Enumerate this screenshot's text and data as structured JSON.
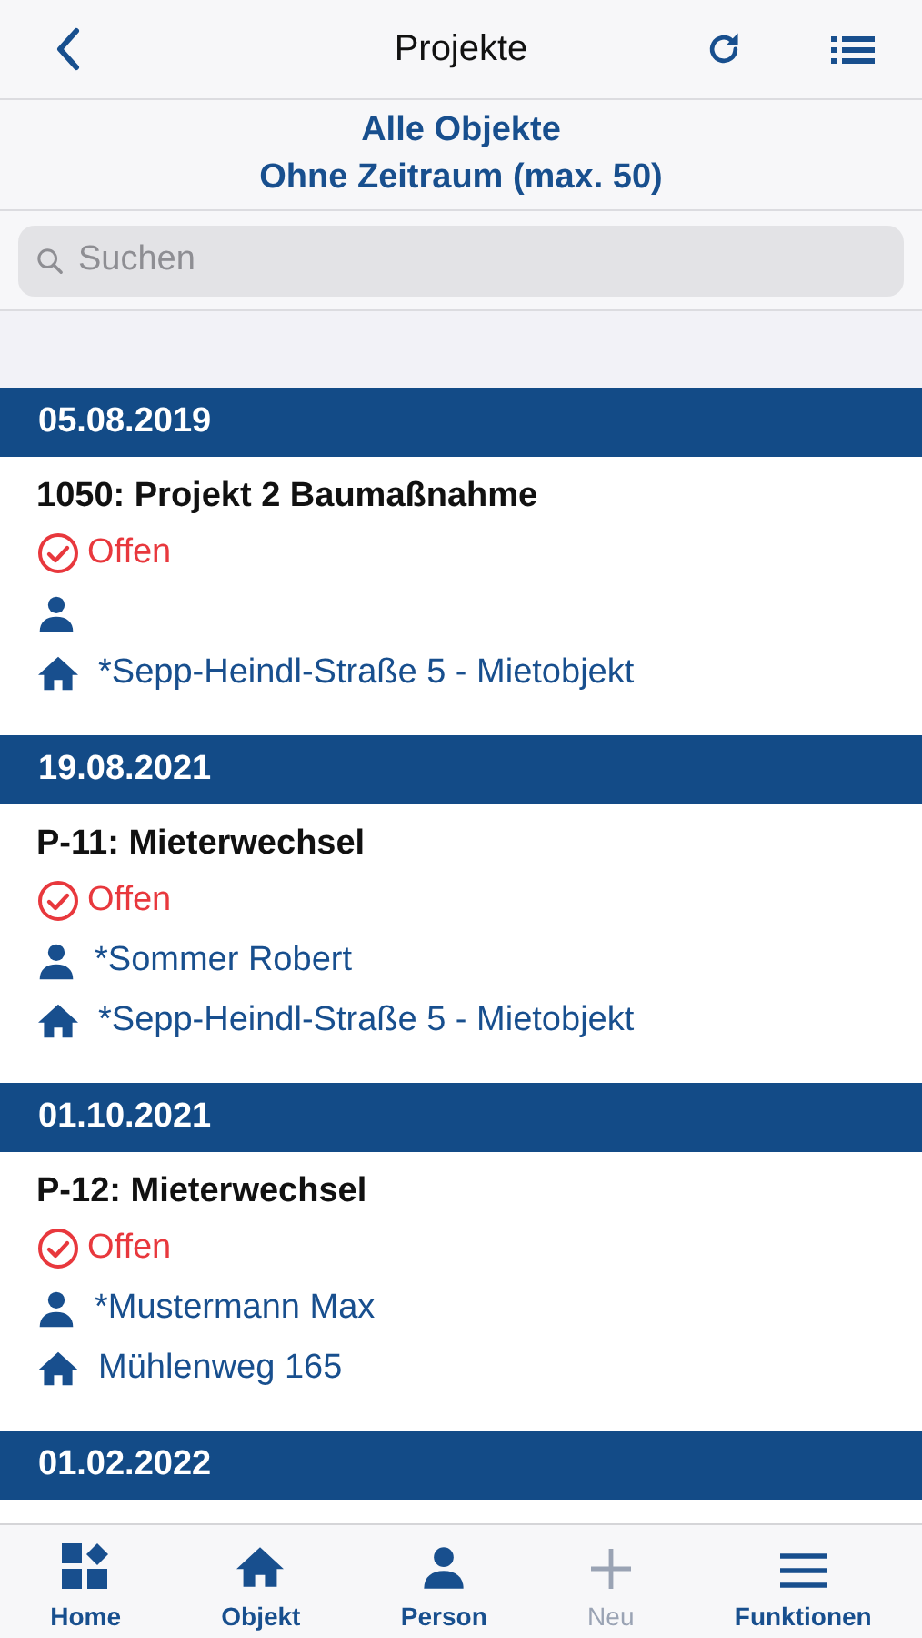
{
  "header": {
    "title": "Projekte"
  },
  "filter": {
    "line_1": "Alle Objekte",
    "line_2": "Ohne Zeitraum (max. 50)"
  },
  "search": {
    "placeholder": "Suchen"
  },
  "groups": [
    {
      "date": "05.08.2019",
      "items": [
        {
          "title": "1050: Projekt 2 Baumaßnahme",
          "status": "Offen",
          "property": "*Sepp-Heindl-Straße 5 - Mietobjekt"
        }
      ]
    },
    {
      "date": "19.08.2021",
      "items": [
        {
          "title": "P-11: Mieterwechsel",
          "status": "Offen",
          "person": "*Sommer Robert",
          "property": "*Sepp-Heindl-Straße 5 - Mietobjekt"
        }
      ]
    },
    {
      "date": "01.10.2021",
      "items": [
        {
          "title": "P-12: Mieterwechsel",
          "status": "Offen",
          "person": "*Mustermann Max",
          "property": "Mühlenweg 165"
        }
      ]
    },
    {
      "date": "01.02.2022"
    }
  ],
  "tab_bar": [
    {
      "kind": "home",
      "label": "Home",
      "disabled": false
    },
    {
      "kind": "object",
      "label": "Objekt",
      "disabled": false
    },
    {
      "kind": "person",
      "label": "Person",
      "disabled": false
    },
    {
      "kind": "new",
      "label": "Neu",
      "disabled": true
    },
    {
      "kind": "menu",
      "label": "Funktionen",
      "disabled": false
    }
  ]
}
